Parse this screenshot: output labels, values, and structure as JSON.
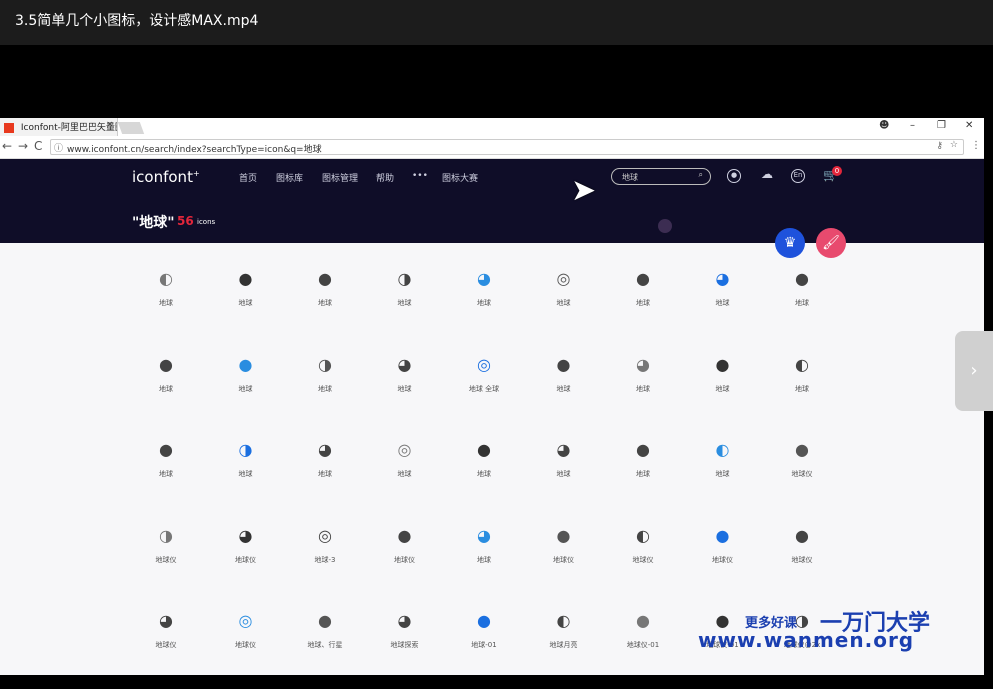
{
  "player": {
    "title": "3.5简单几个小图标，设计感MAX.mp4"
  },
  "browser": {
    "tab_title": "Iconfont-阿里巴巴矢量图标",
    "tab_close": "×",
    "url": "www.iconfont.cn/search/index?searchType=icon&q=地球",
    "window_buttons": {
      "account": "☻",
      "minimize": "–",
      "restore": "❐",
      "close": "✕"
    },
    "nav": {
      "back": "←",
      "forward": "→",
      "reload": "C"
    }
  },
  "site": {
    "logo": "iconfont",
    "logo_mark": "+",
    "nav": [
      "首页",
      "图标库",
      "图标管理",
      "帮助",
      "•••",
      "图标大赛"
    ],
    "search_value": "地球",
    "header_icons": [
      "github-icon",
      "upload-icon",
      "language-icon",
      "cart-icon"
    ],
    "lang_label": "En",
    "cart_count": "0",
    "result_title": "\"地球\"",
    "result_count": "56",
    "result_unit": "icons",
    "fab_crown": "♛",
    "fab_paint": "🖌"
  },
  "icon_grid": {
    "rows": [
      [
        "地球",
        "地球",
        "地球",
        "地球",
        "地球",
        "地球",
        "地球",
        "地球",
        "地球"
      ],
      [
        "地球",
        "地球",
        "地球",
        "地球",
        "地球 全球",
        "地球",
        "地球",
        "地球",
        "地球"
      ],
      [
        "地球",
        "地球",
        "地球",
        "地球",
        "地球",
        "地球",
        "地球",
        "地球",
        "地球仪"
      ],
      [
        "地球仪",
        "地球仪",
        "地球-3",
        "地球仪",
        "地球",
        "地球仪",
        "地球仪",
        "地球仪",
        "地球仪"
      ],
      [
        "地球仪",
        "地球仪",
        "地球、行星",
        "地球探索",
        "地球-01",
        "地球月亮",
        "地球仪-01",
        "地球仪-01",
        "地球仪@2x"
      ]
    ]
  },
  "overlay": {
    "side_arrow": "›",
    "watermark_text": "更多好课",
    "watermark_brand": "一万门大学",
    "watermark_url": "www.wanmen.org"
  }
}
